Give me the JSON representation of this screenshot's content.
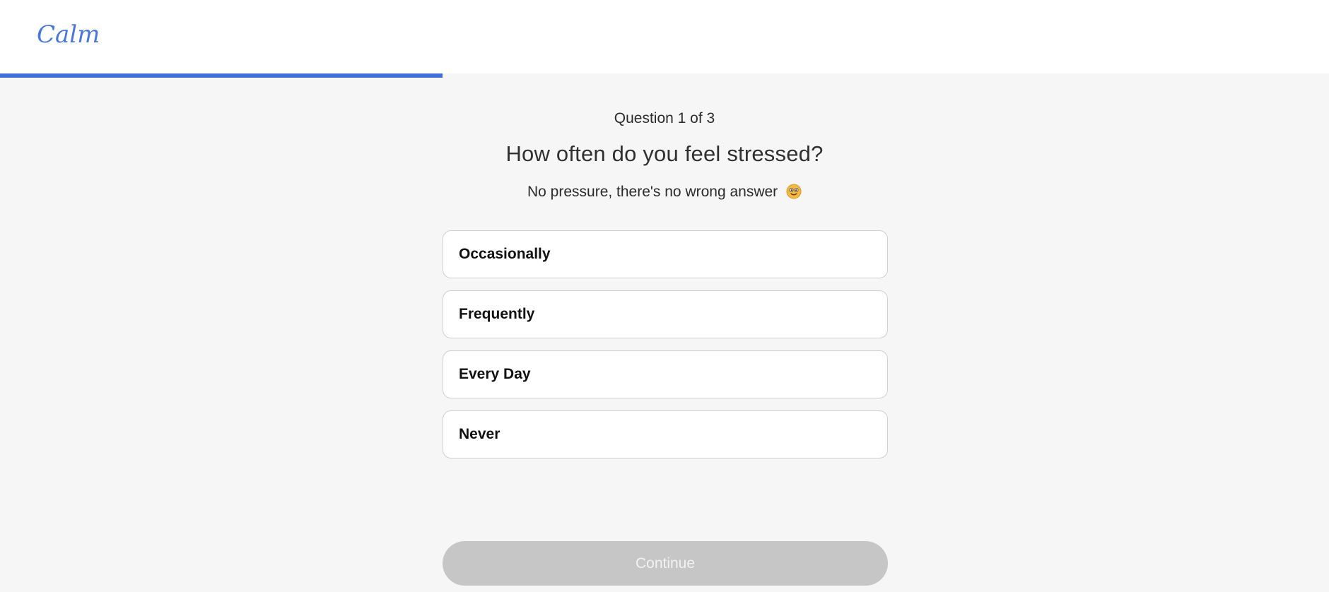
{
  "brand": {
    "logo_text": "Calm",
    "logo_color": "#4a77dc",
    "accent_color": "#3f6fd8"
  },
  "progress": {
    "current": 1,
    "total": 3,
    "fraction": 0.333
  },
  "question": {
    "counter": "Question 1 of 3",
    "title": "How often do you feel stressed?",
    "subtitle": "No pressure, there's no wrong answer",
    "subtitle_icon": "smiling-face-emoji-icon"
  },
  "options": [
    {
      "label": "Occasionally"
    },
    {
      "label": "Frequently"
    },
    {
      "label": "Every Day"
    },
    {
      "label": "Never"
    }
  ],
  "continue": {
    "label": "Continue",
    "state": "disabled",
    "color": "#c6c6c6"
  }
}
